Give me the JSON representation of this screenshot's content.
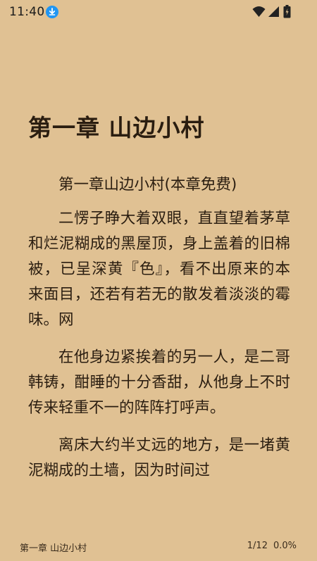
{
  "status_bar": {
    "time": "11:40",
    "icons": [
      "download-icon",
      "wifi-icon",
      "signal-icon",
      "battery-icon"
    ]
  },
  "reader": {
    "chapter_title": "第一章 山边小村",
    "paragraphs": [
      "第一章山边小村(本章免费)",
      "二愣子睁大着双眼，直直望着茅草和烂泥糊成的黑屋顶，身上盖着的旧棉被，已呈深黄『色』，看不出原来的本来面目，还若有若无的散发着淡淡的霉味。网",
      "在他身边紧挨着的另一人，是二哥韩铸，酣睡的十分香甜，从他身上不时传来轻重不一的阵阵打呼声。",
      "离床大约半丈远的地方，是一堵黄泥糊成的土墙，因为时间过"
    ]
  },
  "footer": {
    "chapter": "第一章 山边小村",
    "page": "1/12",
    "percent": "0.0%"
  },
  "colors": {
    "background": "#e0c193",
    "text": "#2a1d10",
    "accent": "#2196f3"
  }
}
